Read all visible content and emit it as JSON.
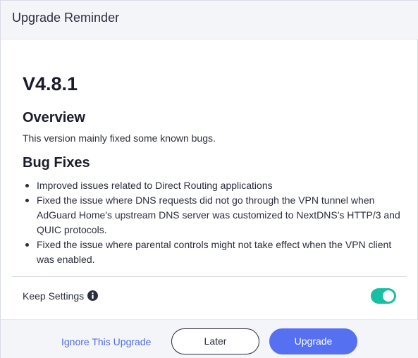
{
  "dialog": {
    "title": "Upgrade Reminder"
  },
  "release": {
    "version": "V4.8.1",
    "overview_heading": "Overview",
    "overview_text": "This version mainly fixed some known bugs.",
    "bugfix_heading": "Bug Fixes",
    "fixes": [
      "Improved issues related to Direct Routing applications",
      "Fixed the issue where DNS requests did not go through the VPN tunnel when AdGuard Home's upstream DNS server was customized to NextDNS's HTTP/3 and QUIC protocols.",
      "Fixed the issue where parental controls might not take effect when the VPN client was enabled."
    ]
  },
  "settings": {
    "keep_label": "Keep Settings",
    "info_icon": "info-icon",
    "keep_enabled": true,
    "toggle_color": "#17bfa3"
  },
  "footer": {
    "ignore_label": "Ignore This Upgrade",
    "later_label": "Later",
    "upgrade_label": "Upgrade",
    "accent_color": "#5570f0"
  }
}
